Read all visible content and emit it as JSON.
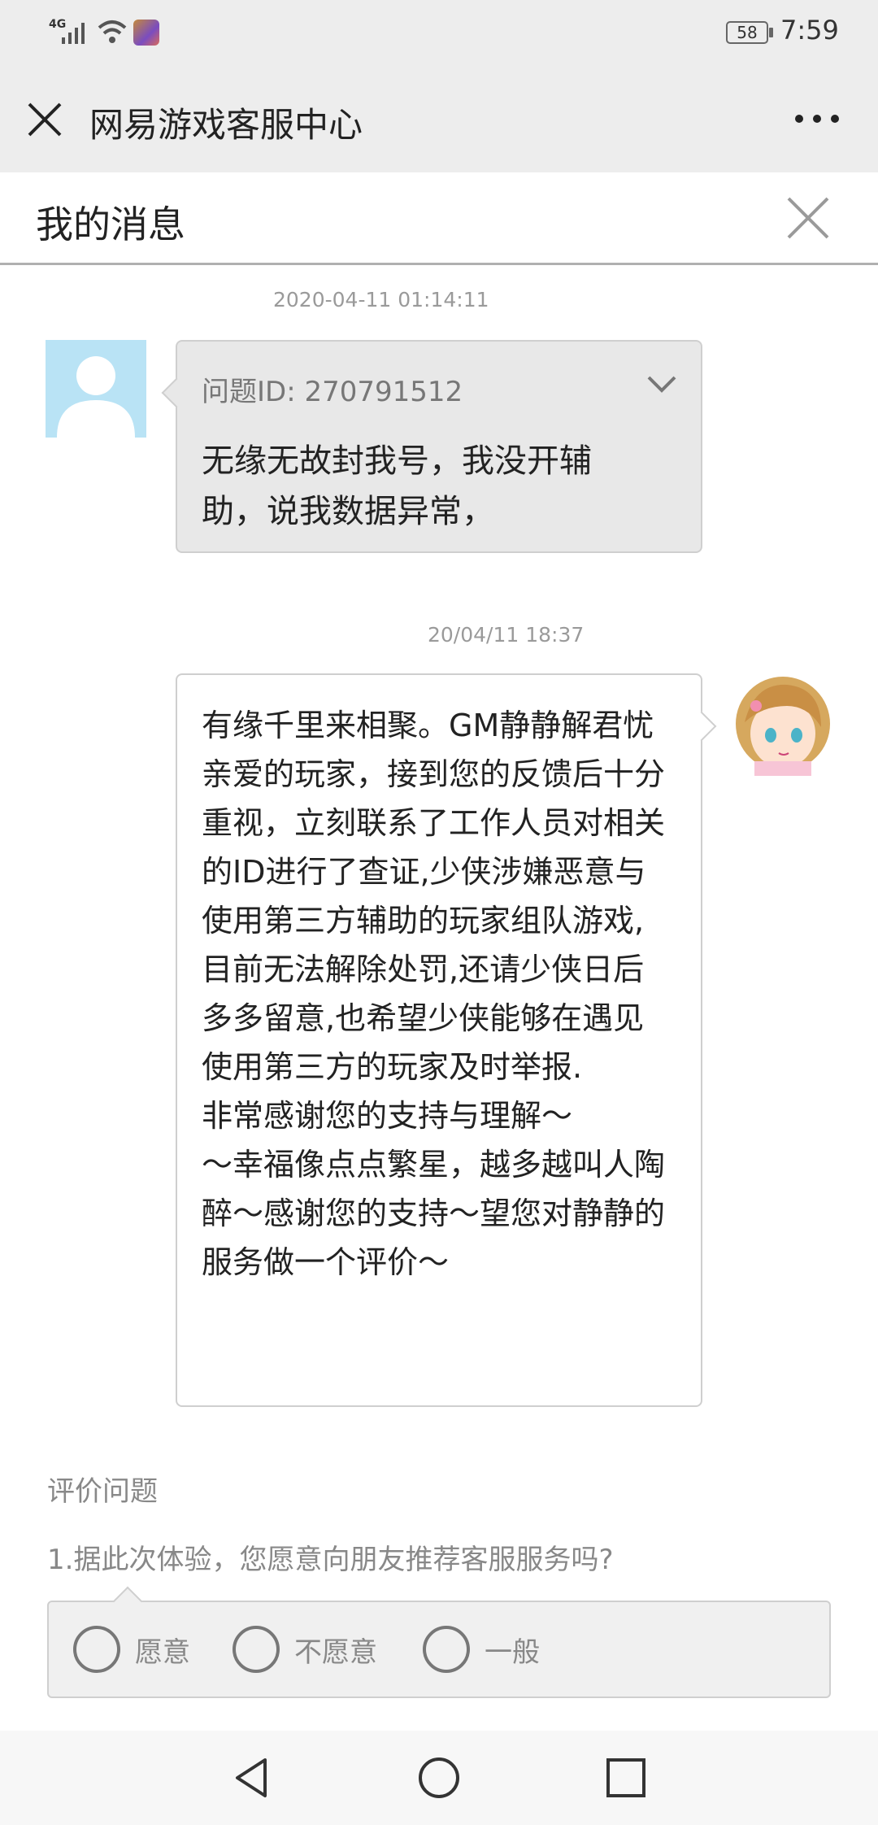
{
  "status_bar": {
    "network": "4G",
    "battery": "58",
    "time": "7:59"
  },
  "title_bar": {
    "title": "网易游戏客服中心"
  },
  "messages_header": {
    "title": "我的消息"
  },
  "conversation": [
    {
      "timestamp": "2020-04-11 01:14:11",
      "question_id": "问题ID: 270791512",
      "text": "无缘无故封我号，我没开辅助，说我数据异常，"
    },
    {
      "timestamp": "20/04/11 18:37",
      "text": "有缘千里来相聚。GM静静解君忧　　　亲爱的玩家，接到您的反馈后十分重视，立刻联系了工作人员对相关的ID进行了查证,少侠涉嫌恶意与使用第三方辅助的玩家组队游戏,目前无法解除处罚,还请少侠日后多多留意,也希望少侠能够在遇见使用第三方的玩家及时举报.　　　非常感谢您的支持与理解～　　　～幸福像点点繁星，越多越叫人陶醉～感谢您的支持～望您对静静的服务做一个评价～"
    }
  ],
  "evaluation": {
    "title": "评价问题",
    "question": "1.据此次体验，您愿意向朋友推荐客服服务吗?",
    "options": [
      "愿意",
      "不愿意",
      "一般"
    ]
  },
  "icons": {
    "close": "close-icon",
    "more": "more-icon",
    "chevron": "chevron-down-icon",
    "back": "nav-back-icon",
    "home": "nav-home-icon",
    "recent": "nav-recent-icon"
  }
}
